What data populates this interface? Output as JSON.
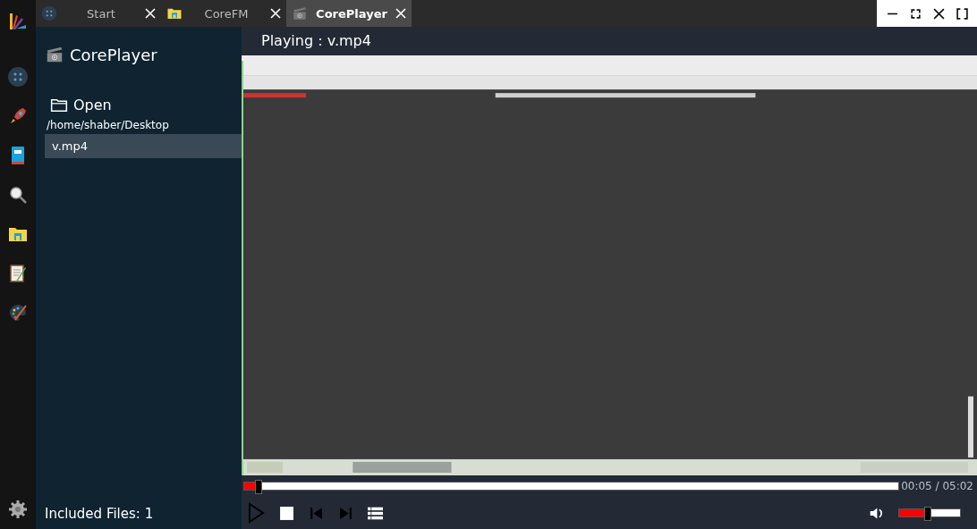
{
  "tabs": [
    {
      "label": "Start",
      "selected": false,
      "kind": "apps"
    },
    {
      "label": "CoreFM",
      "selected": false,
      "kind": "folder"
    },
    {
      "label": "CorePlayer",
      "selected": true,
      "kind": "player"
    }
  ],
  "sidebar": {
    "title": "CorePlayer",
    "open": "Open",
    "path": "/home/shaber/Desktop",
    "files": [
      {
        "name": "v.mp4",
        "selected": true
      }
    ],
    "footer": "Included Files: 1"
  },
  "player": {
    "now_playing": "Playing : v.mp4",
    "seek": {
      "level": 0.02
    },
    "time": "00:05 / 05:02",
    "volume": {
      "level": 0.46
    }
  }
}
